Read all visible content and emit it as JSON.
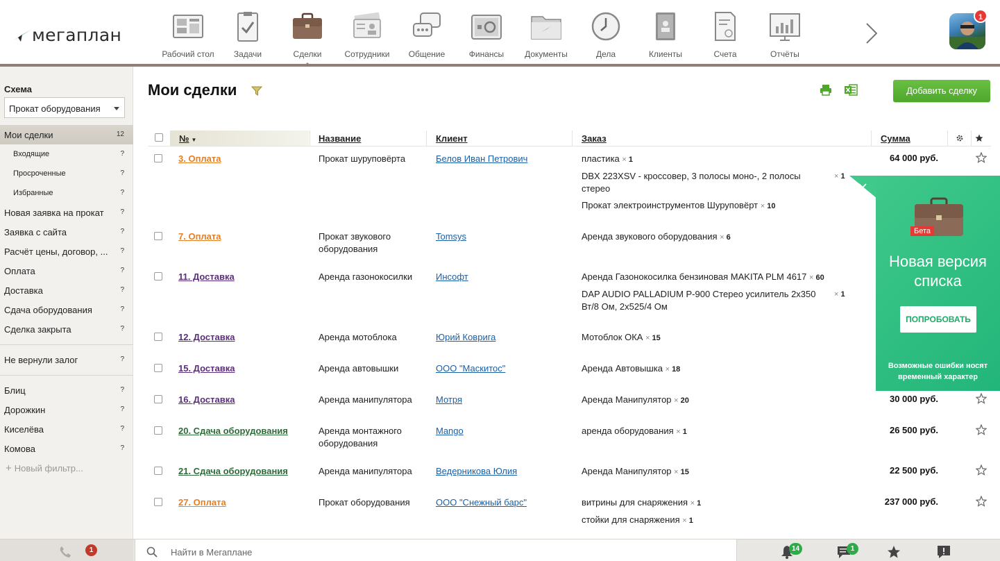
{
  "app": {
    "logo_text": "мегаплан"
  },
  "nav": [
    {
      "label": "Рабочий стол",
      "icon": "desktop-icon"
    },
    {
      "label": "Задачи",
      "icon": "tasks-icon"
    },
    {
      "label": "Сделки",
      "icon": "briefcase-icon",
      "active": true
    },
    {
      "label": "Сотрудники",
      "icon": "employees-icon"
    },
    {
      "label": "Общение",
      "icon": "chat-icon"
    },
    {
      "label": "Финансы",
      "icon": "safe-icon"
    },
    {
      "label": "Документы",
      "icon": "folder-icon"
    },
    {
      "label": "Дела",
      "icon": "clock-icon"
    },
    {
      "label": "Клиенты",
      "icon": "contacts-icon"
    },
    {
      "label": "Счета",
      "icon": "invoice-icon"
    },
    {
      "label": "Отчёты",
      "icon": "reports-icon"
    }
  ],
  "user": {
    "notifications": "1"
  },
  "sidebar": {
    "scheme_label": "Схема",
    "scheme_value": "Прокат оборудования",
    "items": [
      {
        "label": "Мои сделки",
        "count": "12",
        "active": true
      },
      {
        "label": "Входящие",
        "count": "?",
        "sub": true
      },
      {
        "label": "Просроченные",
        "count": "?",
        "sub": true
      },
      {
        "label": "Избранные",
        "count": "?",
        "sub": true
      },
      {
        "label": "Новая заявка на прокат",
        "count": "?"
      },
      {
        "label": "Заявка с сайта",
        "count": "?"
      },
      {
        "label": "Расчёт цены, договор, ...",
        "count": "?"
      },
      {
        "label": "Оплата",
        "count": "?"
      },
      {
        "label": "Доставка",
        "count": "?"
      },
      {
        "label": "Сдача оборудования",
        "count": "?"
      },
      {
        "label": "Сделка закрыта",
        "count": "?"
      },
      {
        "label": "Не вернули залог",
        "count": "?"
      },
      {
        "label": "Блиц",
        "count": "?"
      },
      {
        "label": "Дорожкин",
        "count": "?"
      },
      {
        "label": "Киселёва",
        "count": "?"
      },
      {
        "label": "Комова",
        "count": "?"
      }
    ],
    "new_filter": "Новый фильтр..."
  },
  "main": {
    "title": "Мои сделки",
    "add_button": "Добавить сделку"
  },
  "table": {
    "columns": {
      "num": "№",
      "name": "Название",
      "client": "Клиент",
      "order": "Заказ",
      "sum": "Сумма"
    },
    "rows": [
      {
        "deal": "3. Оплата",
        "color": "orange",
        "name": "Прокат шуруповёрта",
        "client": "Белов Иван Петрович",
        "sum": "64 000  руб.",
        "order": [
          {
            "item": "пластика",
            "qty": "1"
          },
          {
            "item": "DBX 223XSV - кроссовер, 3 полосы моно-, 2 полосы стерео",
            "qty": "1"
          },
          {
            "item": "Прокат электроинструментов Шуруповёрт",
            "qty": "10"
          }
        ]
      },
      {
        "deal": "7. Оплата",
        "color": "orange",
        "name": "Прокат звукового оборудования",
        "client": "Tomsys",
        "sum": "",
        "order": [
          {
            "item": "Аренда звукового оборудования",
            "qty": "6"
          }
        ]
      },
      {
        "deal": "11. Доставка",
        "color": "purple",
        "name": "Аренда газонокосилки",
        "client": "Инсофт",
        "sum": "",
        "order": [
          {
            "item": "Аренда Газонокосилка бензиновая MAKITA PLM 4617",
            "qty": "60"
          },
          {
            "item": "DAP AUDIO PALLADIUM P-900 Стерео усилитель 2x350 Вт/8 Ом, 2x525/4 Ом",
            "qty": "1"
          }
        ]
      },
      {
        "deal": "12. Доставка",
        "color": "purple",
        "name": "Аренда мотоблока",
        "client": "Юрий Коврига",
        "sum": "",
        "order": [
          {
            "item": "Мотоблок ОКА",
            "qty": "15"
          }
        ]
      },
      {
        "deal": "15. Доставка",
        "color": "purple",
        "name": "Аренда автовышки",
        "client": "ООО \"Маскитос\"",
        "sum": "",
        "order": [
          {
            "item": "Аренда Автовышка",
            "qty": "18"
          }
        ]
      },
      {
        "deal": "16. Доставка",
        "color": "purple",
        "name": "Аренда манипулятора",
        "client": "Мотря",
        "sum": "30 000  руб.",
        "order": [
          {
            "item": "Аренда Манипулятор",
            "qty": "20"
          }
        ]
      },
      {
        "deal": "20. Сдача оборудования",
        "color": "green",
        "name": "Аренда монтажного оборудования",
        "client": "Mango",
        "sum": "26 500  руб.",
        "order": [
          {
            "item": "аренда оборудования",
            "qty": "1"
          }
        ]
      },
      {
        "deal": "21. Сдача оборудования",
        "color": "green",
        "name": "Аренда манипулятора",
        "client": "Ведерникова Юлия",
        "sum": "22 500  руб.",
        "order": [
          {
            "item": "Аренда Манипулятор",
            "qty": "15"
          }
        ]
      },
      {
        "deal": "27. Оплата",
        "color": "orange",
        "name": "Прокат оборудования",
        "client": "ООО \"Снежный барс\"",
        "sum": "237 000  руб.",
        "order": [
          {
            "item": "витрины для снаряжения",
            "qty": "1"
          },
          {
            "item": "стойки для снаряжения",
            "qty": "1"
          }
        ]
      }
    ]
  },
  "promo": {
    "beta": "Бета",
    "title": "Новая версия списка",
    "button": "ПОПРОБОВАТЬ",
    "note": "Возможные ошибки носят временный характер"
  },
  "bottom": {
    "calls_badge": "1",
    "search_placeholder": "Найти в Мегаплане",
    "notifications_badge": "14",
    "messages_badge": "1"
  },
  "colors": {
    "accent_green": "#4ea72b",
    "promo_green": "#22b57a",
    "link_orange": "#e67e22",
    "link_purple": "#5b2d7a",
    "link_green": "#2e6b3a",
    "badge_red": "#e53935"
  }
}
